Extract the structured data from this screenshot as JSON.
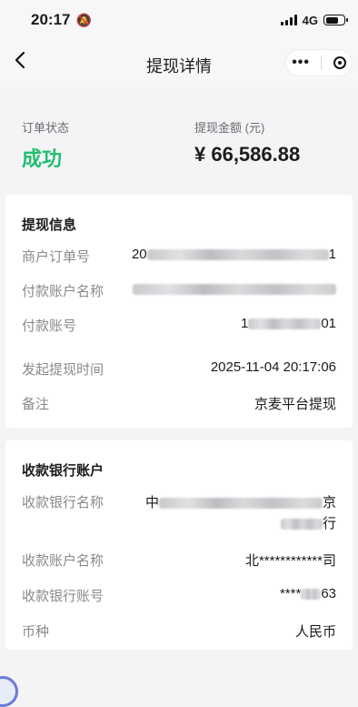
{
  "statusbar": {
    "time": "20:17",
    "network": "4G",
    "mute_icon": "bell-slash-icon"
  },
  "nav": {
    "title": "提现详情",
    "more": "•••"
  },
  "status": {
    "state_label": "订单状态",
    "state_value": "成功",
    "amount_label": "提现金额 (元)",
    "amount_value": "¥ 66,586.88"
  },
  "withdraw_info": {
    "title": "提现信息",
    "rows": [
      {
        "key": "商户订单号",
        "value_prefix": "20",
        "value_suffix": "1"
      },
      {
        "key": "付款账户名称",
        "value_prefix": "",
        "value_suffix": ""
      },
      {
        "key": "付款账号",
        "value_prefix": "1",
        "value_suffix": "01"
      },
      {
        "key": "发起提现时间",
        "value": "2025-11-04 20:17:06"
      },
      {
        "key": "备注",
        "value": "京麦平台提现"
      }
    ]
  },
  "bank_account": {
    "title": "收款银行账户",
    "rows": [
      {
        "key": "收款银行名称",
        "value_line1_prefix": "中",
        "value_line1_suffix": "京",
        "value_line2_suffix": "行"
      },
      {
        "key": "收款账户名称",
        "value": "北************司"
      },
      {
        "key": "收款银行账号",
        "value_prefix": "****",
        "value_suffix": "63"
      },
      {
        "key": "币种",
        "value": "人民币"
      }
    ]
  },
  "colors": {
    "success": "#21bf70",
    "label": "#8a8a8e",
    "background": "#f4f4f6"
  }
}
